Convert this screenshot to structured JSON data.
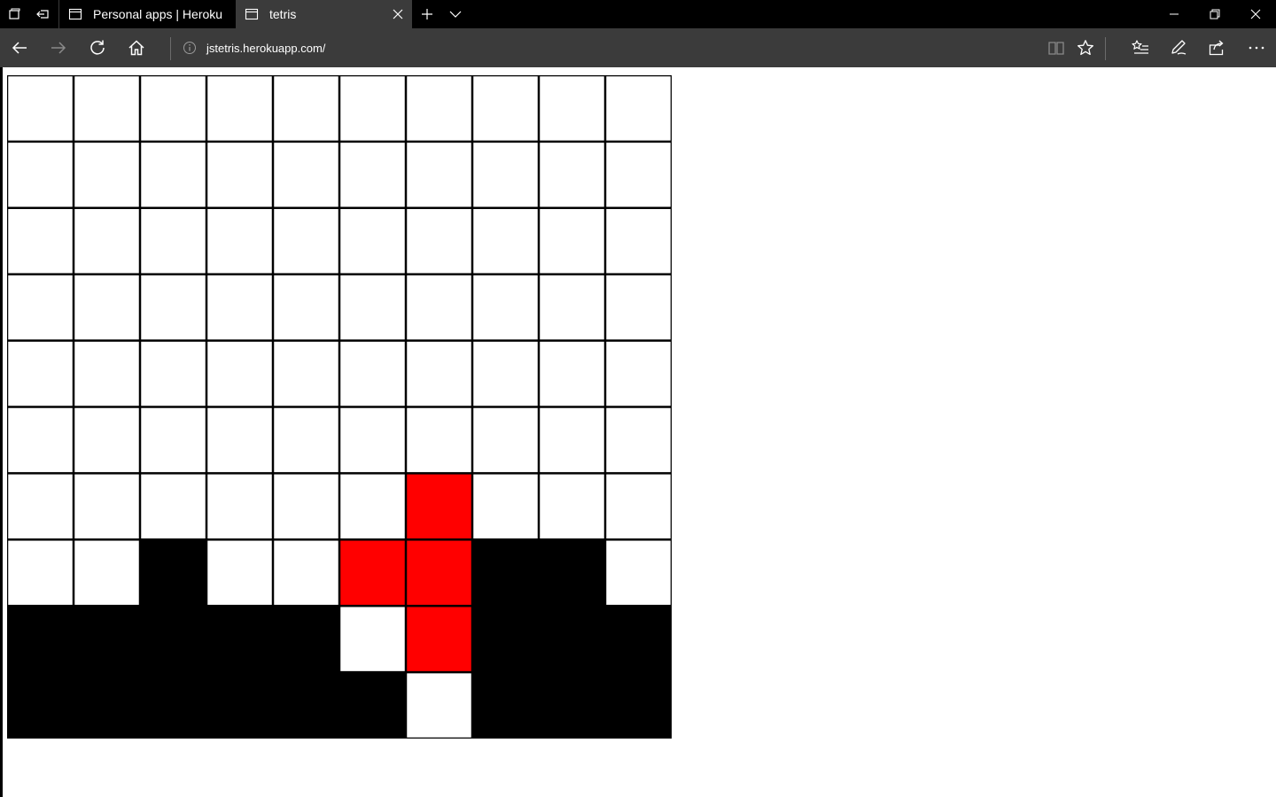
{
  "browser": {
    "tabs": [
      {
        "title": "Personal apps | Heroku",
        "active": false
      },
      {
        "title": "tetris",
        "active": true
      }
    ],
    "address": "jstetris.herokuapp.com/",
    "icons": {
      "tab_manager": "tab-manager-icon",
      "set_aside": "set-aside-tabs-icon",
      "new_tab": "plus-icon",
      "tab_list": "chevron-down-icon",
      "back": "back-arrow-icon",
      "forward": "forward-arrow-icon",
      "refresh": "refresh-icon",
      "home": "home-icon",
      "site_info": "info-icon",
      "reading_view": "book-icon",
      "favorite": "star-icon",
      "favorites_hub": "favorites-list-icon",
      "web_note": "pen-icon",
      "share": "share-icon",
      "more": "ellipsis-icon"
    }
  },
  "game": {
    "columns": 10,
    "rows": 10,
    "colors": {
      "empty": "#ffffff",
      "filled": "#000000",
      "active": "#ff0000",
      "grid": "#000000"
    },
    "legend": {
      "0": "empty",
      "1": "filled",
      "2": "active-piece"
    },
    "grid": [
      [
        0,
        0,
        0,
        0,
        0,
        0,
        0,
        0,
        0,
        0
      ],
      [
        0,
        0,
        0,
        0,
        0,
        0,
        0,
        0,
        0,
        0
      ],
      [
        0,
        0,
        0,
        0,
        0,
        0,
        0,
        0,
        0,
        0
      ],
      [
        0,
        0,
        0,
        0,
        0,
        0,
        0,
        0,
        0,
        0
      ],
      [
        0,
        0,
        0,
        0,
        0,
        0,
        0,
        0,
        0,
        0
      ],
      [
        0,
        0,
        0,
        0,
        0,
        0,
        0,
        0,
        0,
        0
      ],
      [
        0,
        0,
        0,
        0,
        0,
        0,
        2,
        0,
        0,
        0
      ],
      [
        0,
        0,
        1,
        0,
        0,
        2,
        2,
        1,
        1,
        0
      ],
      [
        1,
        1,
        1,
        1,
        1,
        0,
        2,
        1,
        1,
        1
      ],
      [
        1,
        1,
        1,
        1,
        1,
        1,
        0,
        1,
        1,
        1
      ]
    ]
  }
}
